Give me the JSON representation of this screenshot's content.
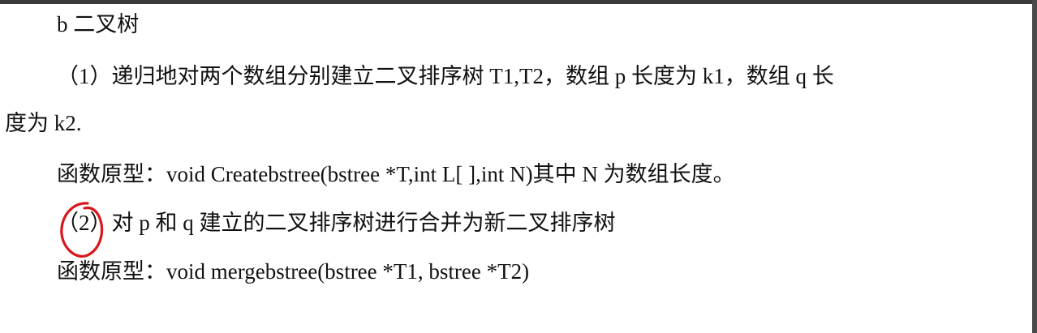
{
  "document": {
    "heading": "b 二叉树",
    "item1_line1": "（1）递归地对两个数组分别建立二叉排序树 T1,T2，数组 p 长度为 k1，数组 q 长",
    "item1_line2": "度为 k2.",
    "item1_prototype": "函数原型：void Createbstree(bstree *T,int L[ ],int N)其中 N 为数组长度。",
    "item2_text": "（2）对 p 和 q 建立的二叉排序树进行合并为新二叉排序树",
    "item2_prototype": "函数原型：void mergebstree(bstree *T1, bstree *T2)"
  },
  "annotation": {
    "type": "handwritten-circle",
    "color": "#d9161c"
  }
}
